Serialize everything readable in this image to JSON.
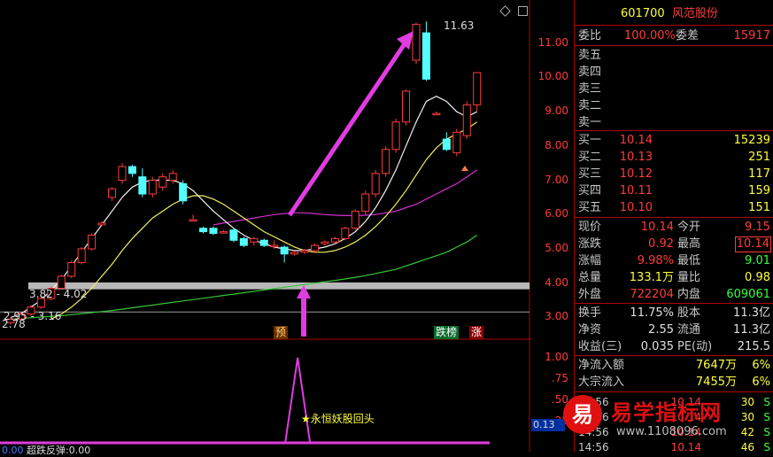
{
  "stock": {
    "code": "601700",
    "name": "风范股份"
  },
  "order_ratio": {
    "label1": "委比",
    "ratio": "100.00%",
    "label2": "委差",
    "diff": "15917"
  },
  "sell": [
    {
      "label": "卖五"
    },
    {
      "label": "卖四"
    },
    {
      "label": "卖三"
    },
    {
      "label": "卖二"
    },
    {
      "label": "卖一"
    }
  ],
  "buy": [
    {
      "label": "买一",
      "price": "10.14",
      "vol": "15239"
    },
    {
      "label": "买二",
      "price": "10.13",
      "vol": "251"
    },
    {
      "label": "买三",
      "price": "10.12",
      "vol": "117"
    },
    {
      "label": "买四",
      "price": "10.11",
      "vol": "159"
    },
    {
      "label": "买五",
      "price": "10.10",
      "vol": "151"
    }
  ],
  "quote": [
    {
      "l1": "现价",
      "v1": "10.14",
      "l2": "今开",
      "v2": "9.15"
    },
    {
      "l1": "涨跌",
      "v1": "0.92",
      "l2": "最高",
      "v2": "10.14"
    },
    {
      "l1": "涨幅",
      "v1": "9.98%",
      "l2": "最低",
      "v2": "9.01"
    },
    {
      "l1": "总量",
      "v1": "133.1万",
      "l2": "量比",
      "v2": "0.98"
    },
    {
      "l1": "外盘",
      "v1": "722204",
      "l2": "内盘",
      "v2": "609061"
    }
  ],
  "fund": [
    {
      "l1": "换手",
      "v1": "11.75%",
      "l2": "股本",
      "v2": "11.3亿"
    },
    {
      "l1": "净资",
      "v1": "2.55",
      "l2": "流通",
      "v2": "11.3亿"
    },
    {
      "l1": "收益(三)",
      "v1": "0.035",
      "l2": "PE(动)",
      "v2": "215.5"
    }
  ],
  "flow": [
    {
      "label": "净流入额",
      "amount": "7647万",
      "pct": "6%"
    },
    {
      "label": "大宗流入",
      "amount": "7455万",
      "pct": "6%"
    }
  ],
  "ticks": [
    {
      "time": "14:56",
      "price": "10.14",
      "vol": "30",
      "side": "S"
    },
    {
      "time": "14:56",
      "price": "10.14",
      "vol": "30",
      "side": "S"
    },
    {
      "time": "14:56",
      "price": "10.14",
      "vol": "42",
      "side": "S"
    },
    {
      "time": "14:56",
      "price": "10.14",
      "vol": "46",
      "side": "S"
    }
  ],
  "price_axis": [
    "11.00",
    "10.00",
    "9.00",
    "8.00",
    "7.00",
    "6.00",
    "5.00",
    "4.00",
    "3.00"
  ],
  "ind_axis": [
    "1.00",
    ".75",
    ".50",
    ".25"
  ],
  "chart_labels": {
    "high_label": "11.63",
    "zone1": "3.82 - 4.02",
    "zone2": "2.95 - 3.16",
    "low_label": "2.78",
    "tag_pre": "预",
    "tag_list": "跌榜",
    "tag_rise": "涨",
    "signal": "永恒妖股回头",
    "ind_value": "0.13",
    "bottom_label": "0.00",
    "bottom_name": "超跌反弹:0.00"
  },
  "watermark": {
    "logo_char": "易",
    "title": "易学指标网",
    "url": "www.1108096.com"
  },
  "chart_data": {
    "type": "candlestick",
    "y_range": [
      2.7,
      12.0
    ],
    "candles": [
      {
        "o": 2.85,
        "c": 2.95,
        "h": 3.0,
        "l": 2.8
      },
      {
        "o": 2.95,
        "c": 3.1,
        "h": 3.15,
        "l": 2.9
      },
      {
        "o": 3.1,
        "c": 3.3,
        "h": 3.35,
        "l": 3.05
      },
      {
        "o": 3.3,
        "c": 3.55,
        "h": 3.6,
        "l": 3.25
      },
      {
        "o": 3.55,
        "c": 3.85,
        "h": 3.9,
        "l": 3.5
      },
      {
        "o": 3.85,
        "c": 4.2,
        "h": 4.25,
        "l": 3.8
      },
      {
        "o": 4.2,
        "c": 4.6,
        "h": 4.65,
        "l": 4.15
      },
      {
        "o": 4.6,
        "c": 5.0,
        "h": 5.05,
        "l": 4.55
      },
      {
        "o": 5.0,
        "c": 5.4,
        "h": 5.45,
        "l": 4.95
      },
      {
        "o": 5.7,
        "c": 5.75,
        "h": 5.8,
        "l": 5.7
      },
      {
        "o": 6.5,
        "c": 6.75,
        "h": 6.8,
        "l": 6.4
      },
      {
        "o": 7.0,
        "c": 7.4,
        "h": 7.5,
        "l": 6.9
      },
      {
        "o": 7.4,
        "c": 7.2,
        "h": 7.45,
        "l": 7.1
      },
      {
        "o": 7.1,
        "c": 6.6,
        "h": 7.35,
        "l": 6.5
      },
      {
        "o": 6.6,
        "c": 7.0,
        "h": 7.1,
        "l": 6.5
      },
      {
        "o": 6.8,
        "c": 7.1,
        "h": 7.2,
        "l": 6.7
      },
      {
        "o": 7.0,
        "c": 7.2,
        "h": 7.3,
        "l": 6.9
      },
      {
        "o": 6.9,
        "c": 6.4,
        "h": 7.0,
        "l": 6.3
      },
      {
        "o": 5.85,
        "c": 5.85,
        "h": 6.0,
        "l": 5.8
      },
      {
        "o": 5.6,
        "c": 5.5,
        "h": 5.65,
        "l": 5.45
      },
      {
        "o": 5.6,
        "c": 5.45,
        "h": 5.65,
        "l": 5.4
      },
      {
        "o": 5.5,
        "c": 5.5,
        "h": 5.55,
        "l": 5.45
      },
      {
        "o": 5.55,
        "c": 5.25,
        "h": 5.6,
        "l": 5.2
      },
      {
        "o": 5.3,
        "c": 5.1,
        "h": 5.35,
        "l": 5.05
      },
      {
        "o": 5.2,
        "c": 5.3,
        "h": 5.35,
        "l": 5.1
      },
      {
        "o": 5.25,
        "c": 5.1,
        "h": 5.3,
        "l": 5.05
      },
      {
        "o": 5.1,
        "c": 5.1,
        "h": 5.25,
        "l": 5.0
      },
      {
        "o": 5.05,
        "c": 4.85,
        "h": 5.1,
        "l": 4.6
      },
      {
        "o": 4.85,
        "c": 4.9,
        "h": 4.95,
        "l": 4.8
      },
      {
        "o": 4.9,
        "c": 4.95,
        "h": 5.0,
        "l": 4.85
      },
      {
        "o": 4.95,
        "c": 5.1,
        "h": 5.15,
        "l": 4.9
      },
      {
        "o": 5.15,
        "c": 5.2,
        "h": 5.25,
        "l": 5.1
      },
      {
        "o": 5.2,
        "c": 5.3,
        "h": 5.35,
        "l": 5.15
      },
      {
        "o": 5.3,
        "c": 5.6,
        "h": 5.65,
        "l": 5.25
      },
      {
        "o": 5.6,
        "c": 6.1,
        "h": 6.15,
        "l": 5.55
      },
      {
        "o": 6.1,
        "c": 6.6,
        "h": 6.7,
        "l": 6.0
      },
      {
        "o": 6.6,
        "c": 7.2,
        "h": 7.3,
        "l": 6.5
      },
      {
        "o": 7.2,
        "c": 7.9,
        "h": 8.0,
        "l": 7.1
      },
      {
        "o": 7.9,
        "c": 8.7,
        "h": 8.8,
        "l": 7.8
      },
      {
        "o": 8.7,
        "c": 9.6,
        "h": 9.65,
        "l": 8.6
      },
      {
        "o": 10.5,
        "c": 11.55,
        "h": 11.6,
        "l": 10.4
      },
      {
        "o": 11.3,
        "c": 9.95,
        "h": 11.63,
        "l": 9.9
      },
      {
        "o": 8.95,
        "c": 8.95,
        "h": 9.0,
        "l": 8.9
      },
      {
        "o": 8.2,
        "c": 7.9,
        "h": 8.4,
        "l": 7.85
      },
      {
        "o": 7.8,
        "c": 8.4,
        "h": 8.5,
        "l": 7.7
      },
      {
        "o": 8.3,
        "c": 9.2,
        "h": 9.3,
        "l": 8.2
      },
      {
        "o": 9.2,
        "c": 10.14,
        "h": 10.14,
        "l": 9.01
      }
    ],
    "ma_white": [
      3.0,
      3.1,
      3.3,
      3.5,
      3.8,
      4.1,
      4.5,
      4.9,
      5.3,
      5.7,
      6.1,
      6.5,
      6.8,
      6.95,
      7.0,
      7.0,
      7.0,
      6.9,
      6.7,
      6.4,
      6.1,
      5.85,
      5.6,
      5.4,
      5.25,
      5.15,
      5.05,
      5.0,
      4.95,
      4.95,
      5.0,
      5.05,
      5.15,
      5.3,
      5.5,
      5.8,
      6.2,
      6.7,
      7.3,
      8.0,
      8.7,
      9.3,
      9.45,
      9.3,
      9.0,
      8.85,
      9.0
    ],
    "ma_yellow": [
      null,
      null,
      null,
      null,
      2.95,
      3.1,
      3.3,
      3.55,
      3.85,
      4.2,
      4.55,
      4.95,
      5.3,
      5.6,
      5.9,
      6.1,
      6.3,
      6.45,
      6.55,
      6.55,
      6.45,
      6.3,
      6.1,
      5.9,
      5.7,
      5.5,
      5.35,
      5.2,
      5.05,
      4.95,
      4.9,
      4.9,
      4.95,
      5.05,
      5.2,
      5.4,
      5.65,
      5.95,
      6.3,
      6.7,
      7.15,
      7.6,
      7.95,
      8.2,
      8.35,
      8.5,
      8.7
    ],
    "ma_magenta": [
      null,
      null,
      null,
      null,
      null,
      null,
      null,
      null,
      null,
      null,
      null,
      null,
      null,
      null,
      null,
      null,
      null,
      null,
      null,
      null,
      5.7,
      5.75,
      5.8,
      5.85,
      5.9,
      5.95,
      6.0,
      6.03,
      6.05,
      6.05,
      6.03,
      6.0,
      5.98,
      5.97,
      5.97,
      5.98,
      6.0,
      6.05,
      6.1,
      6.2,
      6.3,
      6.45,
      6.6,
      6.75,
      6.9,
      7.1,
      7.3
    ],
    "ma_green": [
      2.95,
      2.97,
      2.99,
      3.01,
      3.03,
      3.05,
      3.08,
      3.11,
      3.14,
      3.17,
      3.2,
      3.24,
      3.28,
      3.32,
      3.36,
      3.4,
      3.44,
      3.48,
      3.52,
      3.56,
      3.6,
      3.64,
      3.68,
      3.72,
      3.76,
      3.8,
      3.84,
      3.88,
      3.92,
      3.96,
      4.0,
      4.04,
      4.08,
      4.12,
      4.17,
      4.22,
      4.28,
      4.34,
      4.4,
      4.5,
      4.6,
      4.7,
      4.8,
      4.9,
      5.05,
      5.2,
      5.4
    ],
    "indicator": {
      "spike_index": 27,
      "value": 1.0,
      "base": 0.0
    }
  }
}
